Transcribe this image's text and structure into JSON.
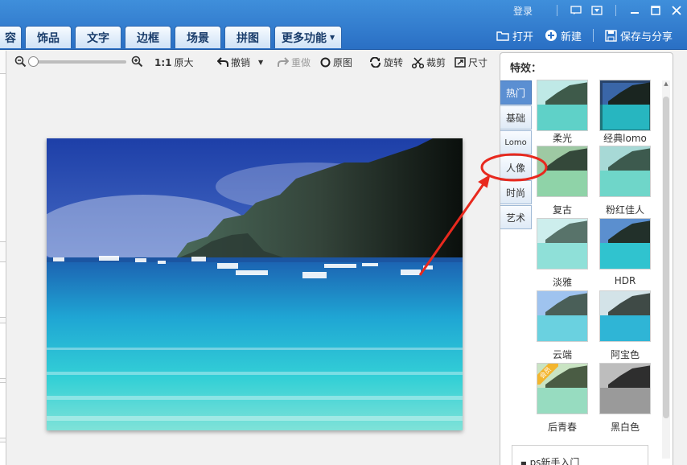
{
  "window": {
    "login_label": "登录"
  },
  "tabs": [
    {
      "label": "容"
    },
    {
      "label": "饰品"
    },
    {
      "label": "文字"
    },
    {
      "label": "边框"
    },
    {
      "label": "场景"
    },
    {
      "label": "拼图"
    },
    {
      "label": "更多功能"
    }
  ],
  "actions": {
    "open": "打开",
    "new": "新建",
    "save_share": "保存与分享"
  },
  "toolbar": {
    "ratio_label": "1:1",
    "original_size": "原大",
    "undo": "撤销",
    "redo": "重做",
    "original": "原图",
    "rotate": "旋转",
    "crop": "裁剪",
    "size": "尺寸"
  },
  "effects_panel": {
    "title": "特效：",
    "categories": [
      "热门",
      "基础",
      "Lomo",
      "人像",
      "时尚",
      "艺术"
    ],
    "active_category": "热门",
    "items": [
      {
        "label": "柔光"
      },
      {
        "label": "经典lomo"
      },
      {
        "label": "复古"
      },
      {
        "label": "粉红佳人"
      },
      {
        "label": "淡雅"
      },
      {
        "label": "HDR"
      },
      {
        "label": "云端"
      },
      {
        "label": "阿宝色"
      },
      {
        "label": "后青春",
        "vip": true,
        "vip_label": "会员"
      },
      {
        "label": "黑白色"
      }
    ]
  },
  "newbie_link": "ps新手入门",
  "colors": {
    "topbar": "#3179cf",
    "annotation": "#e8291e",
    "active_category": "#5b8fd2"
  }
}
